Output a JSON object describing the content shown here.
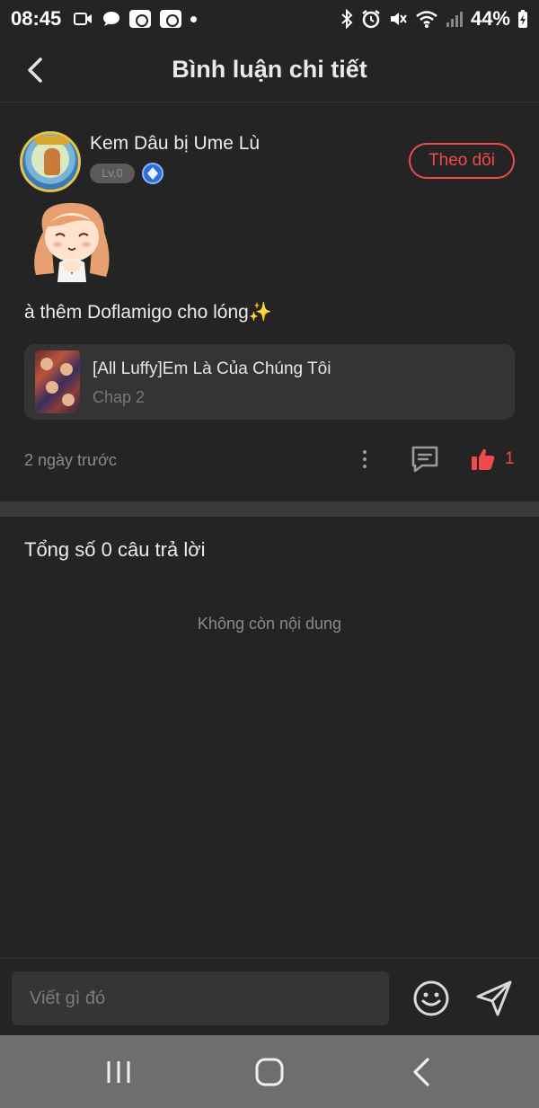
{
  "status_bar": {
    "time": "08:45",
    "battery": "44%"
  },
  "header": {
    "title": "Bình luận chi tiết"
  },
  "comment": {
    "username": "Kem Dâu bị Ume Lù",
    "level": "Lv.0",
    "follow_label": "Theo dõi",
    "text": "à thêm Doflamigo cho lóng",
    "emoji": "✨",
    "story": {
      "title": "[All Luffy]Em Là Của Chúng Tôi",
      "chapter": "Chap 2"
    },
    "time_ago": "2 ngày trước",
    "like_count": "1"
  },
  "replies": {
    "total_label": "Tổng số 0 câu trả lời",
    "empty_label": "Không còn nội dung"
  },
  "input": {
    "placeholder": "Viết gì đó"
  },
  "colors": {
    "accent": "#ee4b4b",
    "background": "#242424"
  }
}
